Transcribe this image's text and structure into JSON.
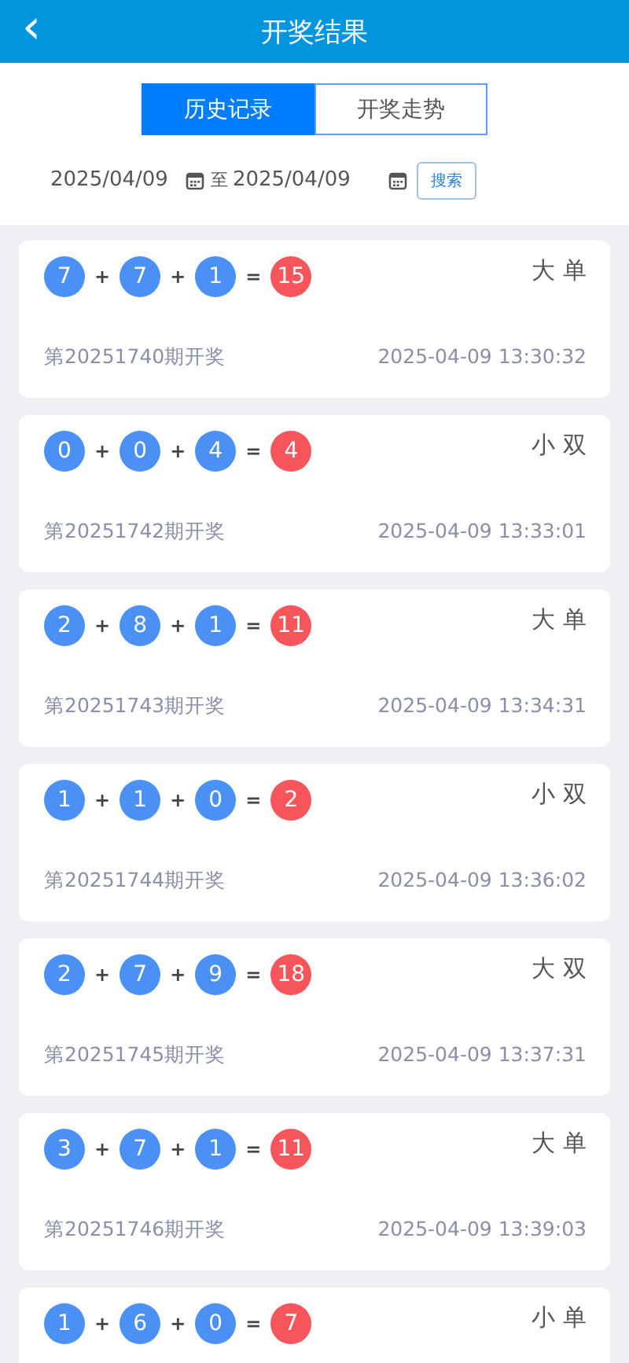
{
  "header": {
    "back": "‹",
    "title": "开奖结果"
  },
  "tabs": [
    {
      "label": "历史记录",
      "selected": true
    },
    {
      "label": "开奖走势",
      "selected": false
    }
  ],
  "filter": {
    "start": "2025/04/09",
    "to": "至",
    "end": "2025/04/09",
    "search": "搜索"
  },
  "results": [
    {
      "items": [
        {
          "kind": "ball",
          "text": "7"
        },
        {
          "kind": "op",
          "text": "+"
        },
        {
          "kind": "ball",
          "text": "7"
        },
        {
          "kind": "op",
          "text": "+"
        },
        {
          "kind": "ball",
          "text": "1"
        },
        {
          "kind": "op",
          "text": "="
        },
        {
          "kind": "sum",
          "text": "15"
        }
      ],
      "label": "大 单",
      "issue": "第20251740期开奖",
      "time": "2025-04-09 13:30:32"
    },
    {
      "items": [
        {
          "kind": "ball",
          "text": "0"
        },
        {
          "kind": "op",
          "text": "+"
        },
        {
          "kind": "ball",
          "text": "0"
        },
        {
          "kind": "op",
          "text": "+"
        },
        {
          "kind": "ball",
          "text": "4"
        },
        {
          "kind": "op",
          "text": "="
        },
        {
          "kind": "sum",
          "text": "4"
        }
      ],
      "label": "小 双",
      "issue": "第20251742期开奖",
      "time": "2025-04-09 13:33:01"
    },
    {
      "items": [
        {
          "kind": "ball",
          "text": "2"
        },
        {
          "kind": "op",
          "text": "+"
        },
        {
          "kind": "ball",
          "text": "8"
        },
        {
          "kind": "op",
          "text": "+"
        },
        {
          "kind": "ball",
          "text": "1"
        },
        {
          "kind": "op",
          "text": "="
        },
        {
          "kind": "sum",
          "text": "11"
        }
      ],
      "label": "大 单",
      "issue": "第20251743期开奖",
      "time": "2025-04-09 13:34:31"
    },
    {
      "items": [
        {
          "kind": "ball",
          "text": "1"
        },
        {
          "kind": "op",
          "text": "+"
        },
        {
          "kind": "ball",
          "text": "1"
        },
        {
          "kind": "op",
          "text": "+"
        },
        {
          "kind": "ball",
          "text": "0"
        },
        {
          "kind": "op",
          "text": "="
        },
        {
          "kind": "sum",
          "text": "2"
        }
      ],
      "label": "小 双",
      "issue": "第20251744期开奖",
      "time": "2025-04-09 13:36:02"
    },
    {
      "items": [
        {
          "kind": "ball",
          "text": "2"
        },
        {
          "kind": "op",
          "text": "+"
        },
        {
          "kind": "ball",
          "text": "7"
        },
        {
          "kind": "op",
          "text": "+"
        },
        {
          "kind": "ball",
          "text": "9"
        },
        {
          "kind": "op",
          "text": "="
        },
        {
          "kind": "sum",
          "text": "18"
        }
      ],
      "label": "大 双",
      "issue": "第20251745期开奖",
      "time": "2025-04-09 13:37:31"
    },
    {
      "items": [
        {
          "kind": "ball",
          "text": "3"
        },
        {
          "kind": "op",
          "text": "+"
        },
        {
          "kind": "ball",
          "text": "7"
        },
        {
          "kind": "op",
          "text": "+"
        },
        {
          "kind": "ball",
          "text": "1"
        },
        {
          "kind": "op",
          "text": "="
        },
        {
          "kind": "sum",
          "text": "11"
        }
      ],
      "label": "大 单",
      "issue": "第20251746期开奖",
      "time": "2025-04-09 13:39:03"
    },
    {
      "items": [
        {
          "kind": "ball",
          "text": "1"
        },
        {
          "kind": "op",
          "text": "+"
        },
        {
          "kind": "ball",
          "text": "6"
        },
        {
          "kind": "op",
          "text": "+"
        },
        {
          "kind": "ball",
          "text": "0"
        },
        {
          "kind": "op",
          "text": "="
        },
        {
          "kind": "sum",
          "text": "7"
        }
      ],
      "label": "小 单"
    }
  ]
}
